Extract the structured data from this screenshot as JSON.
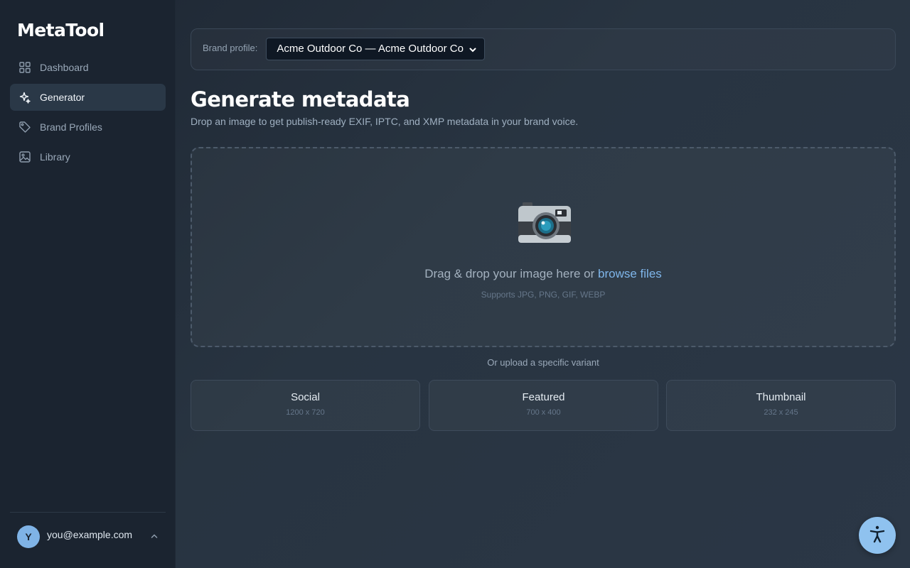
{
  "app": {
    "name": "MetaTool"
  },
  "sidebar": {
    "items": [
      {
        "label": "Dashboard",
        "icon": "grid-icon",
        "active": false
      },
      {
        "label": "Generator",
        "icon": "sparkle-icon",
        "active": true
      },
      {
        "label": "Brand Profiles",
        "icon": "tag-icon",
        "active": false
      },
      {
        "label": "Library",
        "icon": "image-icon",
        "active": false
      }
    ],
    "user": {
      "initial": "Y",
      "email": "you@example.com"
    }
  },
  "brand": {
    "label": "Brand profile:",
    "selected": "Acme Outdoor Co — Acme Outdoor Co"
  },
  "header": {
    "title": "Generate metadata",
    "subtitle": "Drop an image to get publish-ready EXIF, IPTC, and XMP metadata in your brand voice."
  },
  "dropzone": {
    "text": "Drag & drop your image here or ",
    "link": "browse files",
    "hint": "Supports JPG, PNG, GIF, WEBP"
  },
  "variants": {
    "label": "Or upload a specific variant",
    "items": [
      {
        "name": "Social",
        "size": "1200 x 720"
      },
      {
        "name": "Featured",
        "size": "700 x 400"
      },
      {
        "name": "Thumbnail",
        "size": "232 x 245"
      }
    ]
  },
  "colors": {
    "accent": "#7fb6ea",
    "sidebar_bg": "#1b2430",
    "active_item_bg": "#2a3847",
    "a11y_button": "#8fc2ef"
  }
}
